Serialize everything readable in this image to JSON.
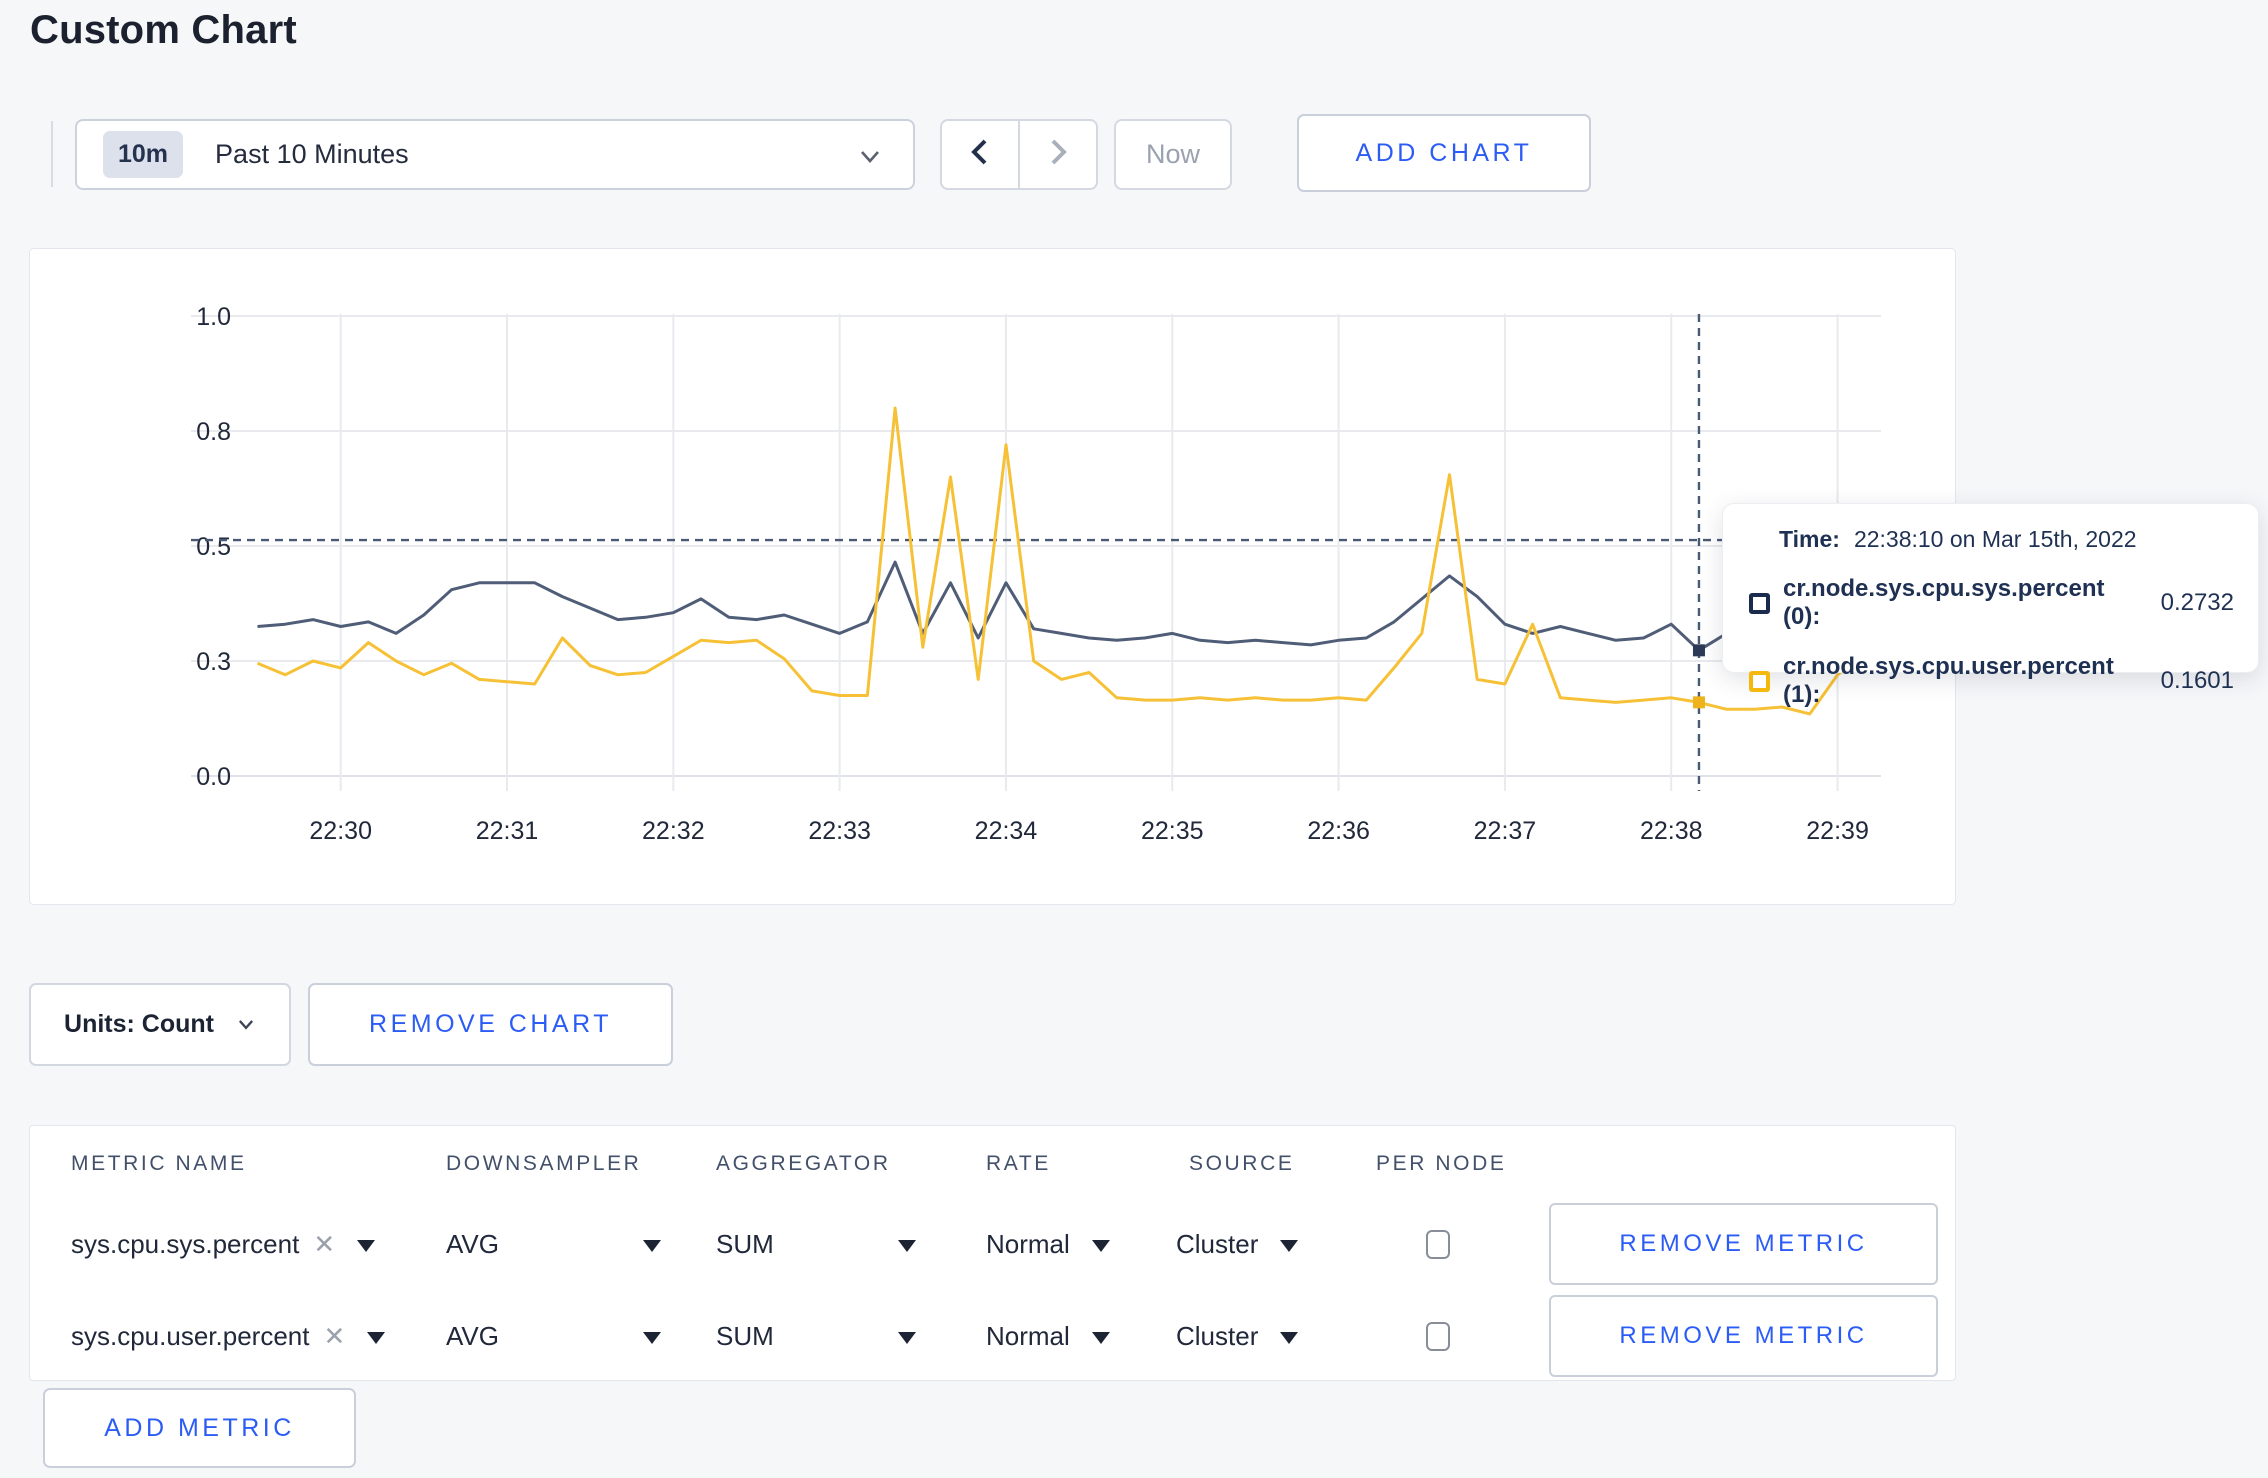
{
  "page": {
    "title": "Custom Chart",
    "accent_blue": "#2b5cf5",
    "background": "#f6f7f9"
  },
  "toolbar": {
    "time_range": {
      "badge": "10m",
      "label": "Past 10 Minutes"
    },
    "now_label": "Now",
    "add_chart_label": "ADD CHART"
  },
  "tooltip": {
    "time_label": "Time:",
    "time_value": "22:38:10 on Mar 15th, 2022",
    "series": [
      {
        "name": "cr.node.sys.cpu.sys.percent (0):",
        "value": "0.2732",
        "color": "#1b2b4e"
      },
      {
        "name": "cr.node.sys.cpu.user.percent (1):",
        "value": "0.1601",
        "color": "#f5b80c"
      }
    ]
  },
  "units_bar": {
    "units_label": "Units: Count",
    "remove_chart_label": "REMOVE CHART"
  },
  "metrics_table": {
    "headers": [
      "METRIC NAME",
      "DOWNSAMPLER",
      "AGGREGATOR",
      "RATE",
      "SOURCE",
      "PER NODE"
    ],
    "rows": [
      {
        "metric": "sys.cpu.sys.percent",
        "downsampler": "AVG",
        "aggregator": "SUM",
        "rate": "Normal",
        "source": "Cluster",
        "per_node_checked": false,
        "remove_label": "REMOVE METRIC"
      },
      {
        "metric": "sys.cpu.user.percent",
        "downsampler": "AVG",
        "aggregator": "SUM",
        "rate": "Normal",
        "source": "Cluster",
        "per_node_checked": false,
        "remove_label": "REMOVE METRIC"
      }
    ],
    "add_metric_label": "ADD METRIC"
  },
  "chart_data": {
    "type": "line",
    "title": "",
    "xlabel": "",
    "ylabel": "",
    "ylim": [
      0,
      1
    ],
    "grid": true,
    "legend_position": "tooltip-overlay",
    "x_start": "22:29:30",
    "x_step_seconds": 10,
    "x_tick_labels": [
      "22:30",
      "22:31",
      "22:32",
      "22:33",
      "22:34",
      "22:35",
      "22:36",
      "22:37",
      "22:38",
      "22:39"
    ],
    "y_ticks": [
      {
        "value": 0.0,
        "label": "0.0"
      },
      {
        "value": 0.25,
        "label": "0.3"
      },
      {
        "value": 0.5,
        "label": "0.5"
      },
      {
        "value": 0.75,
        "label": "0.8"
      },
      {
        "value": 1.0,
        "label": "1.0"
      }
    ],
    "series": [
      {
        "name": "cr.node.sys.cpu.sys.percent",
        "color": "#4f5d77",
        "values": [
          0.325,
          0.33,
          0.34,
          0.325,
          0.335,
          0.31,
          0.35,
          0.405,
          0.42,
          0.42,
          0.42,
          0.39,
          0.365,
          0.34,
          0.345,
          0.355,
          0.385,
          0.345,
          0.34,
          0.35,
          0.33,
          0.31,
          0.335,
          0.465,
          0.31,
          0.42,
          0.3,
          0.42,
          0.32,
          0.31,
          0.3,
          0.295,
          0.3,
          0.31,
          0.295,
          0.29,
          0.295,
          0.29,
          0.285,
          0.295,
          0.3,
          0.335,
          0.385,
          0.435,
          0.39,
          0.33,
          0.31,
          0.325,
          0.31,
          0.295,
          0.3,
          0.33,
          0.2732,
          0.31,
          0.3,
          0.305,
          0.3,
          0.31,
          0.31
        ]
      },
      {
        "name": "cr.node.sys.cpu.user.percent",
        "color": "#f6c136",
        "values": [
          0.245,
          0.22,
          0.25,
          0.235,
          0.29,
          0.25,
          0.22,
          0.245,
          0.21,
          0.205,
          0.2,
          0.3,
          0.24,
          0.22,
          0.225,
          0.26,
          0.295,
          0.29,
          0.295,
          0.255,
          0.185,
          0.175,
          0.175,
          0.8,
          0.28,
          0.65,
          0.21,
          0.72,
          0.25,
          0.21,
          0.225,
          0.17,
          0.165,
          0.165,
          0.17,
          0.165,
          0.17,
          0.165,
          0.165,
          0.17,
          0.165,
          0.235,
          0.31,
          0.655,
          0.21,
          0.2,
          0.33,
          0.17,
          0.165,
          0.16,
          0.165,
          0.17,
          0.1601,
          0.145,
          0.145,
          0.15,
          0.135,
          0.22,
          0.265
        ]
      }
    ],
    "crosshair": {
      "time_label": "22:38:10",
      "x_index": 52,
      "hline_value": 0.513,
      "point_values": [
        0.2732,
        0.1601
      ],
      "dash_color": "#4a5a75"
    }
  }
}
